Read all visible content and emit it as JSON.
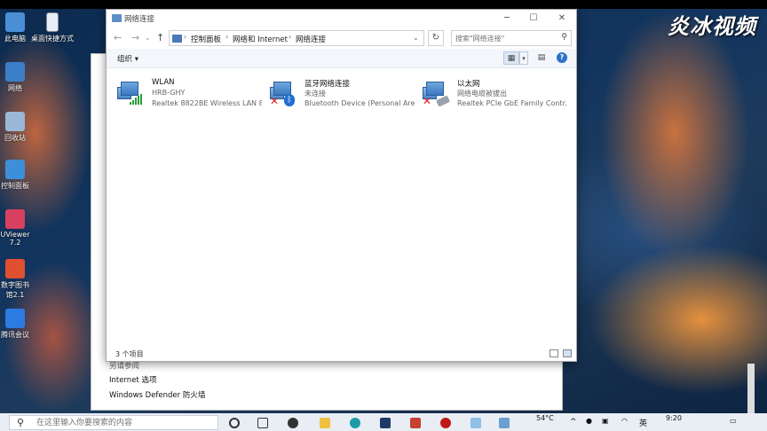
{
  "watermark": "炎冰视频",
  "desktop_icons": [
    {
      "label": "此电脑",
      "icon": "computer-icon",
      "color": "#4a8fd6"
    },
    {
      "label": "网络",
      "icon": "network-icon",
      "color": "#3a7fc8"
    },
    {
      "label": "回收站",
      "icon": "recycle-bin-icon",
      "color": "#9ab8d8"
    },
    {
      "label": "控制面板",
      "icon": "control-panel-icon",
      "color": "#3c8fd8"
    },
    {
      "label": "UViewer 7.2",
      "icon": "uviewer-icon",
      "color": "#d84060"
    },
    {
      "label": "数字图书馆2.1",
      "icon": "digital-library-icon",
      "color": "#e05030"
    },
    {
      "label": "腾讯会议",
      "icon": "tencent-meeting-icon",
      "color": "#2d7ae0"
    }
  ],
  "desktop_shortcut": {
    "label": "桌面快捷方式",
    "icon": "file-shortcut-icon"
  },
  "window": {
    "title": "网络连接",
    "breadcrumbs": [
      "控制面板",
      "网络和 Internet",
      "网络连接"
    ],
    "search_placeholder": "搜索\"网络连接\"",
    "organize_label": "组织 ▾",
    "status_count": "3 个项目"
  },
  "connections": [
    {
      "name": "WLAN",
      "status": "HRB-GHY",
      "device": "Realtek 8822BE Wireless LAN 8...",
      "icon": "wlan-adapter-icon",
      "badge": "signal"
    },
    {
      "name": "蓝牙网络连接",
      "status": "未连接",
      "device": "Bluetooth Device (Personal Are...",
      "icon": "bluetooth-adapter-icon",
      "badge": "bluetooth"
    },
    {
      "name": "以太网",
      "status": "网络电缆被拔出",
      "device": "Realtek PCIe GbE Family Contr...",
      "icon": "ethernet-adapter-icon",
      "badge": "cable"
    }
  ],
  "bg_window": {
    "links": [
      "另请参阅",
      "Internet 选项",
      "Windows Defender 防火墙"
    ]
  },
  "taskbar": {
    "search_placeholder": "在这里输入你要搜索的内容",
    "temperature": "54°C",
    "lang": "英",
    "time": "9:20"
  }
}
